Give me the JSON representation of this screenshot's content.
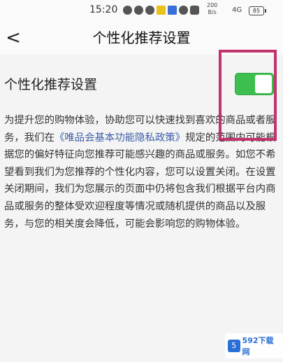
{
  "status_bar": {
    "time": "15:20",
    "net_speed_value": "200",
    "net_speed_unit": "B/s",
    "signal": "4G",
    "battery": "85"
  },
  "nav": {
    "back_label": "<",
    "title": "个性化推荐设置"
  },
  "setting": {
    "label": "个性化推荐设置",
    "enabled": true,
    "toggle_color": "#3dbf4f"
  },
  "description": {
    "part1": "为提升您的购物体验，协助您可以快速找到喜欢的商品或者服务，我们在",
    "link": "《唯品会基本功能隐私政策》",
    "part2": "规定的范围内可能根据您的偏好特征向您推荐可能感兴趣的商品或服务。如您不希望看到我们为您推荐的个性化内容，您可以设置关闭。在设置关闭期间，我们为您展示的页面中仍将包含我们根据平台内商品或服务的整体受欢迎程度等情况或随机提供的商品以及服务，与您的相关度会降低，可能会影响您的购物体验。"
  },
  "watermark": {
    "text": "592下载网"
  }
}
